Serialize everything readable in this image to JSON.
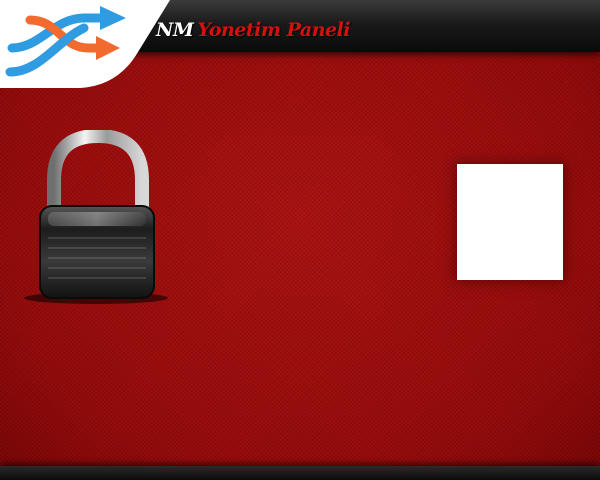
{
  "header": {
    "brand": "NM",
    "title": "Yonetim Paneli"
  },
  "icons": {
    "logo": "shuffle-arrows-icon",
    "lock": "padlock-icon"
  },
  "colors": {
    "background": "#a30f0f",
    "title_accent": "#d80f0f",
    "logo_orange": "#f26a2e",
    "logo_blue": "#2f9be0"
  }
}
